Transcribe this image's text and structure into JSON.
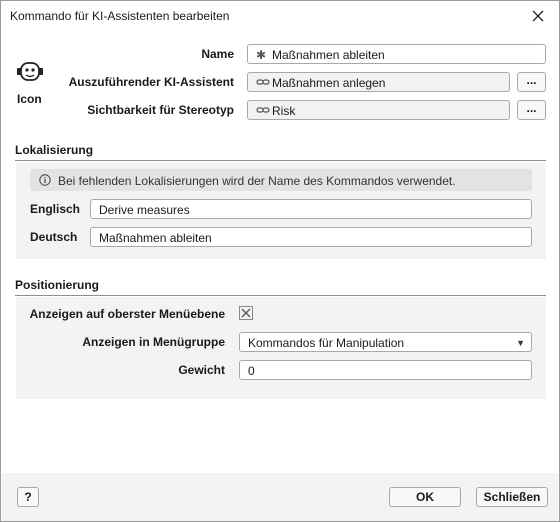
{
  "window": {
    "title": "Kommando für KI-Assistenten bearbeiten"
  },
  "icon_panel": {
    "label": "Icon"
  },
  "fields": {
    "name_label": "Name",
    "name_value": "Maßnahmen ableiten",
    "assistant_label": "Auszuführender KI-Assistent",
    "assistant_value": "Maßnahmen anlegen",
    "visibility_label": "Sichtbarkeit für Stereotyp",
    "visibility_value": "Risk",
    "browse_label": "..."
  },
  "localization": {
    "title": "Lokalisierung",
    "info": "Bei fehlenden Lokalisierungen wird der Name des Kommandos verwendet.",
    "rows": [
      {
        "label": "Englisch",
        "value": "Derive measures"
      },
      {
        "label": "Deutsch",
        "value": "Maßnahmen ableiten"
      }
    ]
  },
  "positioning": {
    "title": "Positionierung",
    "top_menu_label": "Anzeigen auf oberster Menüebene",
    "top_menu_checked": true,
    "menu_group_label": "Anzeigen in Menügruppe",
    "menu_group_value": "Kommandos für Manipulation",
    "weight_label": "Gewicht",
    "weight_value": "0"
  },
  "footer": {
    "help_label": "?",
    "ok_label": "OK",
    "close_label": "Schließen"
  }
}
